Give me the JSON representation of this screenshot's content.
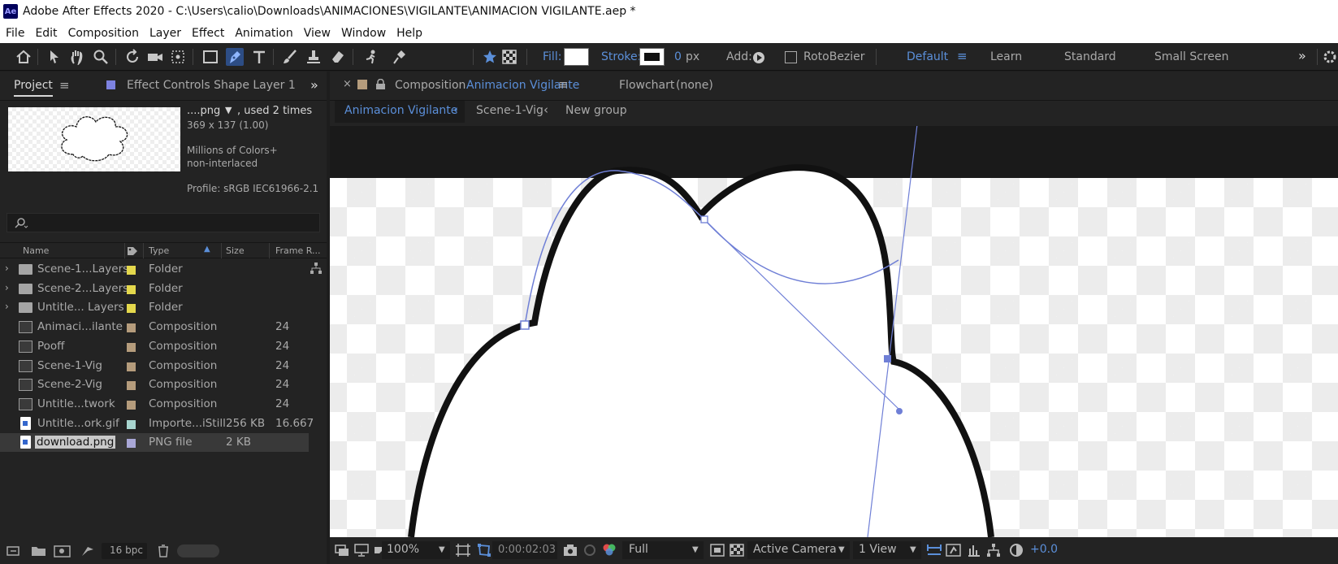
{
  "window": {
    "title": "Adobe After Effects 2020 - C:\\Users\\calio\\Downloads\\ANIMACIONES\\VIGILANTE\\ANIMACION VIGILANTE.aep *",
    "app_icon": "Ae"
  },
  "menu": [
    "File",
    "Edit",
    "Composition",
    "Layer",
    "Effect",
    "Animation",
    "View",
    "Window",
    "Help"
  ],
  "toolbar": {
    "fill_label": "Fill:",
    "stroke_label": "Stroke:",
    "stroke_width": "0",
    "stroke_unit": "px",
    "add_label": "Add:",
    "rotobezier_label": "RotoBezier",
    "workspaces": [
      "Default",
      "Learn",
      "Standard",
      "Small Screen"
    ],
    "more": "»"
  },
  "project_panel": {
    "tab_project": "Project",
    "tab_effect_controls": "Effect Controls Shape Layer 1",
    "expand": "»",
    "item_name": "....png",
    "used": ", used 2 times",
    "dimensions": "369 x 137 (1.00)",
    "colors": "Millions of Colors+",
    "interlace": "non-interlaced",
    "profile": "Profile: sRGB IEC61966-2.1",
    "columns": [
      "Name",
      "Type",
      "Size",
      "Frame R..."
    ],
    "rows": [
      {
        "name": "Scene-1...Layers",
        "type": "Folder",
        "size": "",
        "frame": "",
        "icon": "folder",
        "color": "#e4d84c"
      },
      {
        "name": "Scene-2...Layers",
        "type": "Folder",
        "size": "",
        "frame": "",
        "icon": "folder",
        "color": "#e4d84c"
      },
      {
        "name": "Untitle... Layers",
        "type": "Folder",
        "size": "",
        "frame": "",
        "icon": "folder",
        "color": "#e4d84c"
      },
      {
        "name": "Animaci...ilante",
        "type": "Composition",
        "size": "",
        "frame": "24",
        "icon": "composition",
        "color": "#b59c7c"
      },
      {
        "name": "Pooff",
        "type": "Composition",
        "size": "",
        "frame": "24",
        "icon": "composition",
        "color": "#b59c7c"
      },
      {
        "name": "Scene-1-Vig",
        "type": "Composition",
        "size": "",
        "frame": "24",
        "icon": "composition",
        "color": "#b59c7c"
      },
      {
        "name": "Scene-2-Vig",
        "type": "Composition",
        "size": "",
        "frame": "24",
        "icon": "composition",
        "color": "#b59c7c"
      },
      {
        "name": "Untitle...twork",
        "type": "Composition",
        "size": "",
        "frame": "24",
        "icon": "composition",
        "color": "#b59c7c"
      },
      {
        "name": "Untitle...ork.gif",
        "type": "Importe...iStill",
        "size": "256 KB",
        "frame": "16.667",
        "icon": "file",
        "color": "#a8d5cf"
      },
      {
        "name": "download.png",
        "type": "PNG file",
        "size": "2 KB",
        "frame": "",
        "icon": "file",
        "color": "#a9a7d6"
      }
    ],
    "bpc": "16 bpc"
  },
  "composition_panel": {
    "tab_prefix": "Composition",
    "comp_name": "Animacion Vigilante",
    "flowchart": "Flowchart",
    "flowchart_value": "(none)",
    "breadcrumbs": [
      "Animacion Vigilante",
      "Scene-1-Vig",
      "New group"
    ]
  },
  "viewer": {
    "zoom": "100%",
    "timecode": "0:00:02:03",
    "resolution": "Full",
    "camera": "Active Camera",
    "views": "1 View",
    "exposure": "+0.0",
    "path_color": "#6f7fd6"
  }
}
